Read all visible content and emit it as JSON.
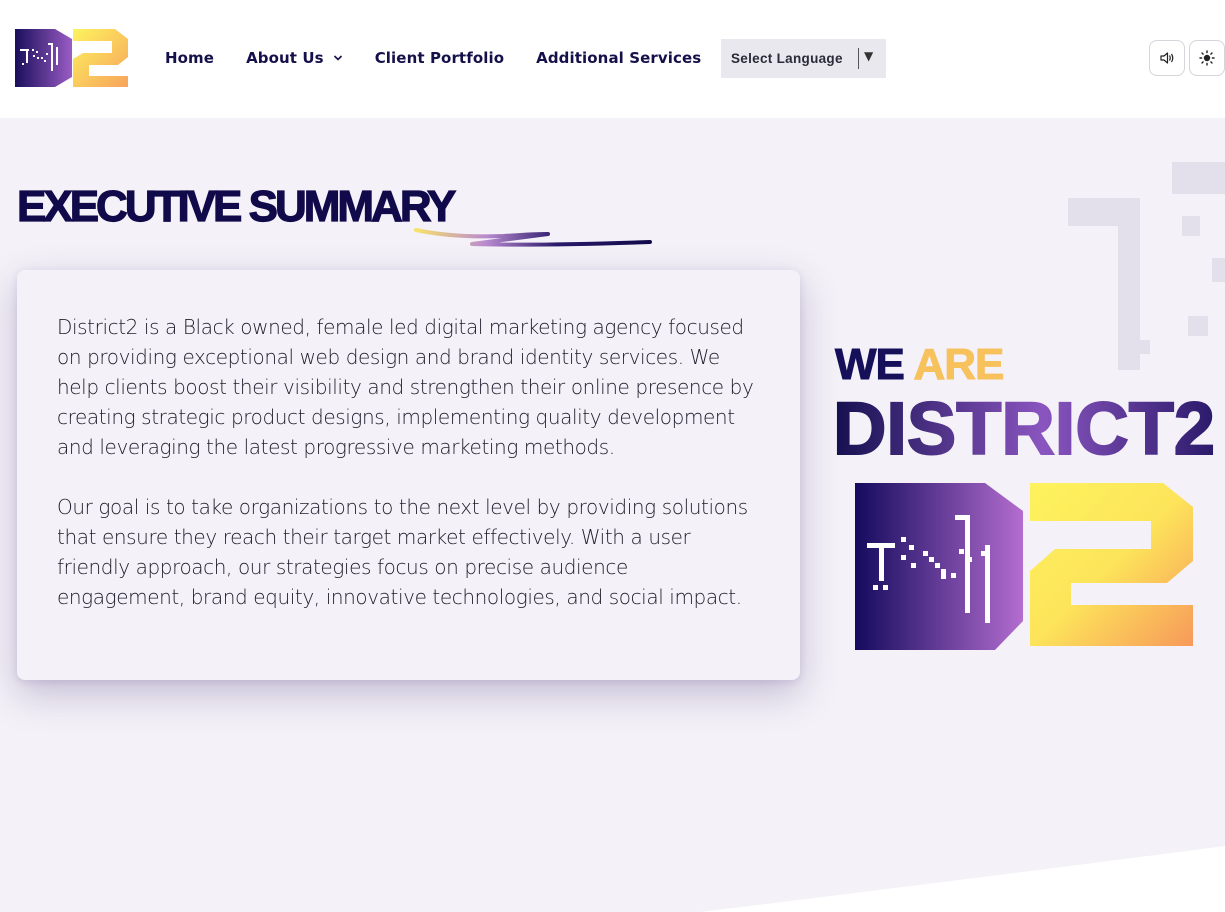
{
  "header": {
    "logo_name": "district2-logo",
    "nav": [
      {
        "label": "Home",
        "has_dropdown": false
      },
      {
        "label": "About Us",
        "has_dropdown": true
      },
      {
        "label": "Client Portfolio",
        "has_dropdown": false
      },
      {
        "label": "Additional Services",
        "has_dropdown": false
      }
    ],
    "language_select": {
      "label": "Select Language",
      "arrow": "▼"
    },
    "icons": [
      "speaker-icon",
      "sun-icon"
    ]
  },
  "hero": {
    "title": "EXECUTIVE SUMMARY",
    "paragraphs": [
      "District2 is a Black owned, female led digital marketing agency focused on providing exceptional web design and brand identity services. We help clients boost their visibility and strengthen their online presence by creating strategic product designs, implementing quality development and leveraging the latest progressive marketing methods.",
      "Our goal is to take organizations to the next level by providing solutions that ensure they reach their target market effectively. With a user friendly approach, our strategies focus on precise audience engagement, brand equity, innovative technologies, and social impact."
    ],
    "we_are_1": "WE",
    "we_are_2": "ARE",
    "brand_name": "DISTRICT2"
  },
  "colors": {
    "navy": "#100a4a",
    "purple": "#7b4fb8",
    "yellow": "#fdf35e",
    "orange": "#f7a35c",
    "gold": "#f7c15c",
    "background": "#f4f1f8"
  }
}
